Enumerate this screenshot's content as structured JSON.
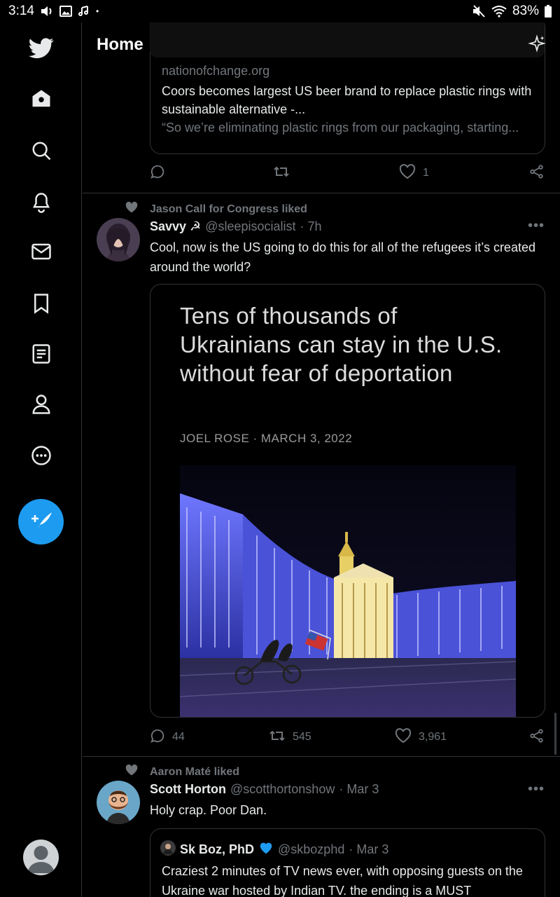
{
  "status_bar": {
    "time": "3:14",
    "battery": "83%"
  },
  "header": {
    "title": "Home"
  },
  "sidebar": {
    "items": [
      {
        "icon": "twitter-bird-logo-icon"
      },
      {
        "icon": "home-icon"
      },
      {
        "icon": "search-icon"
      },
      {
        "icon": "bell-icon"
      },
      {
        "icon": "mail-icon"
      },
      {
        "icon": "bookmark-icon"
      },
      {
        "icon": "list-icon"
      },
      {
        "icon": "profile-icon"
      },
      {
        "icon": "more-icon"
      }
    ],
    "compose_icon": "compose-tweet-icon"
  },
  "tweet1": {
    "link_card": {
      "domain": "nationofchange.org",
      "title": "Coors becomes largest US beer brand to replace plastic rings with sustainable alternative -...",
      "description": "“So we’re eliminating plastic rings from our packaging, starting..."
    },
    "likes": "1"
  },
  "tweet2": {
    "social_context": "Jason Call for Congress liked",
    "name": "Savvy ☭",
    "handle": "@sleepisocialist",
    "time": "· 7h",
    "text": "Cool, now is the US going to do this for all of the refugees it’s created around the world?",
    "media": {
      "headline": "Tens of thousands of Ukrainians can stay in the U.S. without fear of deportation",
      "byline": "JOEL ROSE · MARCH 3, 2022"
    },
    "replies": "44",
    "retweets": "545",
    "likes": "3,961"
  },
  "tweet3": {
    "social_context": "Aaron Maté liked",
    "name": "Scott Horton",
    "handle": "@scotthortonshow",
    "time": "· Mar 3",
    "text": "Holy crap. Poor Dan.",
    "quote": {
      "name": "Sk Boz, PhD",
      "handle": "@skbozphd",
      "time": "· Mar 3",
      "text": "Craziest 2 minutes of TV news ever, with opposing guests on the Ukraine war hosted by Indian TV. the ending is a MUST"
    }
  },
  "colors": {
    "accent": "#1d9bf0",
    "background": "#000000",
    "muted": "#71767b",
    "border": "#2f3336"
  }
}
